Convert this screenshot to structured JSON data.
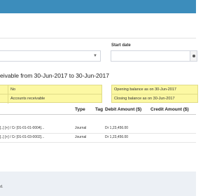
{
  "filters": {
    "start_date_label": "Start date"
  },
  "report": {
    "heading": "eivable from 30-Jun-2017 to 30-Jun-2017"
  },
  "info": {
    "left": [
      "No",
      "Accounts receivable"
    ],
    "right": [
      "Opening balance as on 30-Jun-2017",
      "Closing balance as on 30-Jun-2017"
    ]
  },
  "table": {
    "headers": {
      "type": "Type",
      "tag": "Tag",
      "debit": "Debit Amount ($)",
      "credit": "Credit Amount ($)"
    },
    "rows": [
      {
        "ledger": "[..] [+] / Cr [01-01-01-0004]...",
        "type": "Journal",
        "debit": "Dr 1,23,456.00"
      },
      {
        "ledger": "[..] [+] / Cr [01-01-03-0002]...",
        "type": "Journal",
        "debit": "Dr 1,23,456.00"
      }
    ]
  },
  "footer": {
    "text": "d."
  }
}
